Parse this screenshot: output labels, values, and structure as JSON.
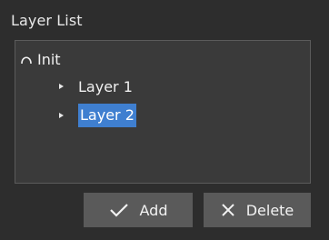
{
  "panel": {
    "title": "Layer List"
  },
  "tree": {
    "root": {
      "label": "Init",
      "icon": "collapse-arc-icon"
    },
    "children": [
      {
        "label": "Layer 1",
        "icon": "bullet-triangle-icon",
        "selected": false
      },
      {
        "label": "Layer 2",
        "icon": "bullet-triangle-icon",
        "selected": true
      }
    ]
  },
  "buttons": {
    "add": {
      "label": "Add",
      "icon": "checkmark-icon"
    },
    "delete": {
      "label": "Delete",
      "icon": "close-x-icon"
    }
  },
  "colors": {
    "background": "#2d2d2d",
    "tree_background": "#3a3a3a",
    "selection": "#3f7fd0",
    "button": "#5a5a5a",
    "text": "#f0f0f0"
  }
}
